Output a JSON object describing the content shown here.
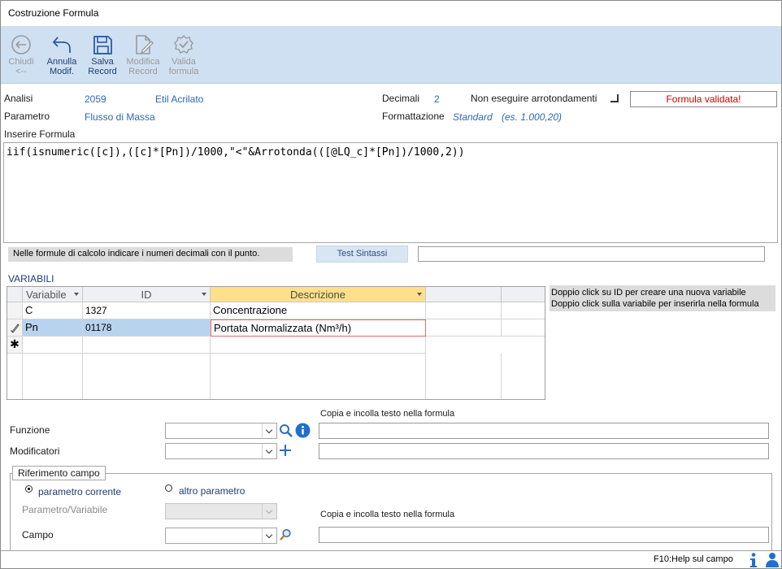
{
  "window": {
    "title": "Costruzione Formula"
  },
  "toolbar": {
    "chiudi": [
      "Chiudi",
      "<--"
    ],
    "annulla": [
      "Annulla",
      "Modif."
    ],
    "salva": [
      "Salva",
      "Record"
    ],
    "modifica": [
      "Modifica",
      "Record"
    ],
    "valida": [
      "Valida",
      "formula"
    ]
  },
  "header": {
    "analisi_label": "Analisi",
    "analisi_id": "2059",
    "analisi_name": "Etil Acrilato",
    "parametro_label": "Parametro",
    "parametro_value": "Flusso di Massa",
    "decimali_label": "Decimali",
    "decimali_value": "2",
    "no_round_label": "Non eseguire arrotondamenti",
    "no_round_checked": false,
    "formattazione_label": "Formattazione",
    "formattazione_value": "Standard",
    "formattazione_example": "(es. 1.000,20)",
    "status_badge": "Formula validata!",
    "status_color": "#d00000"
  },
  "formula": {
    "label": "Inserire Formula",
    "text": "iif(isnumeric([c]),([c]*[Pn])/1000,\"<\"&Arrotonda(([@LQ_c]*[Pn])/1000,2))"
  },
  "note": "Nelle formule di calcolo indicare i numeri decimali con il punto.",
  "test_button": "Test Sintassi",
  "test_result": "",
  "variabili": {
    "label": "VARIABILI",
    "columns": [
      "Variabile",
      "ID",
      "Descrizione"
    ],
    "rows": [
      {
        "variabile": "C",
        "id": "1327",
        "descrizione": "Concentrazione"
      },
      {
        "variabile": "Pn",
        "id": "01178",
        "descrizione": "Portata Normalizzata (Nm³/h)"
      }
    ],
    "hint_line1": "Doppio click su ID per creare una nuova variabile",
    "hint_line2": "Doppio click sulla variabile per inserirla nella formula"
  },
  "funzioni": {
    "copy_label_top": "Copia e incolla testo nella formula",
    "funzione_label": "Funzione",
    "funzione_value": "",
    "funzione_text": "",
    "modificatori_label": "Modificatori",
    "modificatori_value": "",
    "modificatori_text": ""
  },
  "riferimento": {
    "title": "Riferimento campo",
    "radio_current": "parametro corrente",
    "radio_other": "altro parametro",
    "selected": "current",
    "param_var_label": "Parametro/Variabile",
    "param_var_value": "",
    "copy_label": "Copia e incolla testo nella formula",
    "campo_label": "Campo",
    "campo_value": "",
    "campo_text": ""
  },
  "statusbar": {
    "help": "F10:Help sul campo"
  }
}
